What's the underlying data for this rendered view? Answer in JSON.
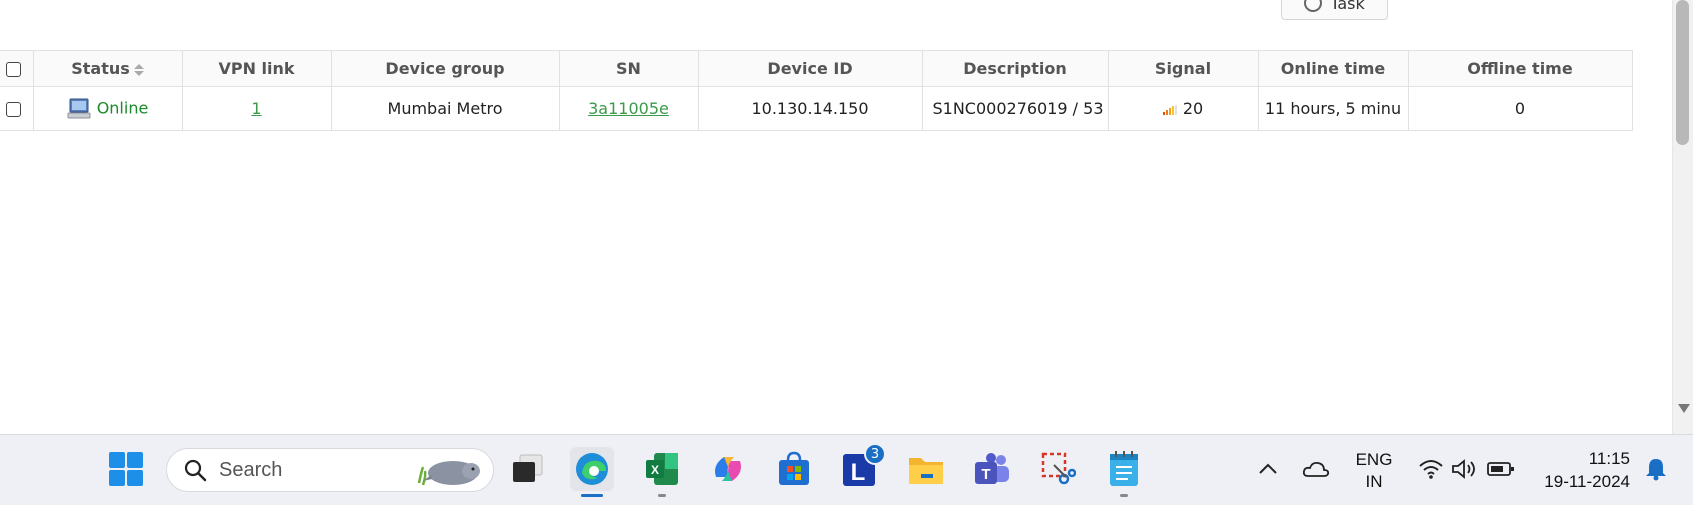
{
  "toolbar": {
    "task_label": "Task"
  },
  "table": {
    "headers": [
      "Status",
      "VPN link",
      "Device group",
      "SN",
      "Device ID",
      "Description",
      "Signal",
      "Online time",
      "Offline time"
    ],
    "rows": [
      {
        "status": "Online",
        "vpn_link": "1",
        "device_group": "Mumbai Metro",
        "sn": "3a11005e",
        "device_id": "10.130.14.150",
        "description": "S1NC000276019 / 53",
        "signal": "20",
        "online_time": "11 hours, 5 minu",
        "offline_time": "0"
      }
    ]
  },
  "taskbar": {
    "search_label": "Search",
    "apps": [
      "start-icon",
      "task-view-icon",
      "edge-icon",
      "excel-icon",
      "copilot-icon",
      "store-icon",
      "l-app-icon",
      "file-explorer-icon",
      "teams-icon",
      "snipping-tool-icon",
      "notepad-icon"
    ],
    "l_app_badge": "3",
    "language": "ENG",
    "region": "IN",
    "time": "11:15",
    "date": "19-11-2024"
  },
  "colors": {
    "online": "#1a8a2a",
    "link": "#3a9a4a",
    "taskbar": "#eef0f5"
  }
}
